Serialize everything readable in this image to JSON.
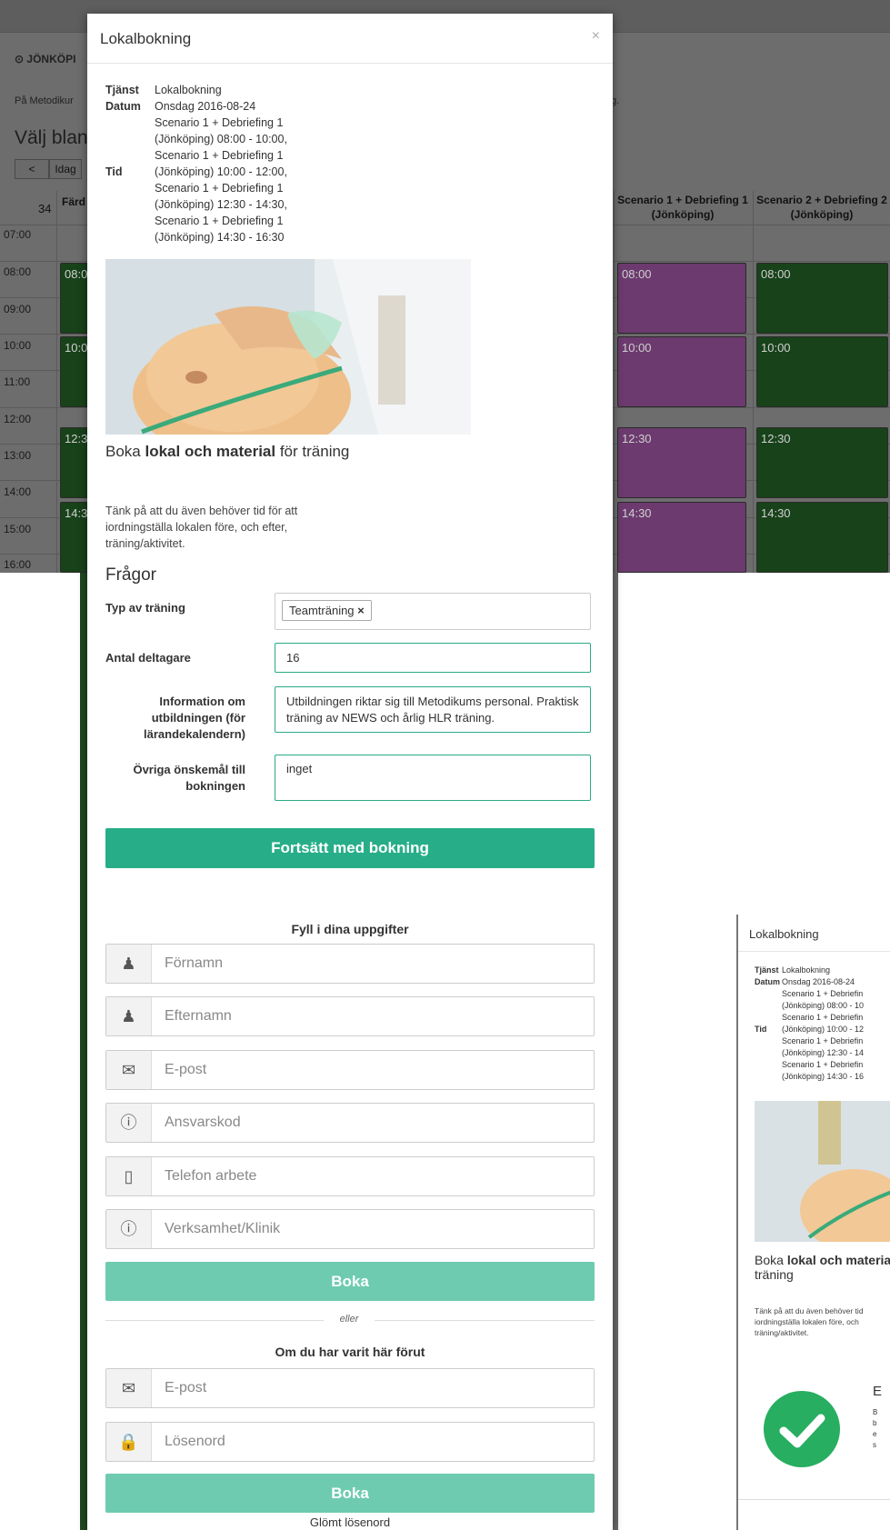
{
  "background": {
    "location_label": "JÖNKÖPI",
    "description_start": "På Metodikur",
    "description_end": "g.",
    "choose_heading": "Välj blan",
    "nav_prev": "<",
    "nav_today": "Idag",
    "week_number": "34",
    "first_column_label": "Färd",
    "column_headers": [
      "Scenario 1 + Debriefing 1 (Jönköping)",
      "Scenario 2 + Debriefing 2 (Jönköping)"
    ],
    "hours": [
      "07:00",
      "08:00",
      "09:00",
      "10:00",
      "11:00",
      "12:00",
      "13:00",
      "14:00",
      "15:00",
      "16:00"
    ],
    "left_event_labels": [
      "08:0",
      "10:0",
      "12:3",
      "14:3"
    ],
    "event_times": [
      "08:00",
      "10:00",
      "12:30",
      "14:30"
    ]
  },
  "modal": {
    "title": "Lokalbokning",
    "close": "×",
    "info": {
      "service_label": "Tjänst",
      "service_value": "Lokalbokning",
      "date_label": "Datum",
      "date_value": "Onsdag 2016-08-24",
      "time_label": "Tid",
      "time_lines": [
        "Scenario 1 + Debriefing 1",
        "(Jönköping) 08:00 - 10:00,",
        "Scenario 1 + Debriefing 1",
        "(Jönköping) 10:00 - 12:00,",
        "Scenario 1 + Debriefing 1",
        "(Jönköping) 12:30 - 14:30,",
        "Scenario 1 + Debriefing 1",
        "(Jönköping) 14:30 - 16:30"
      ]
    },
    "promo": {
      "title_part1": "Boka ",
      "title_bold": "lokal och material",
      "title_part2": " för träning",
      "text": "Tänk på att du även behöver tid för att iordningställa lokalen före, och efter, träning/aktivitet."
    },
    "questions": {
      "heading": "Frågor",
      "training_type_label": "Typ av träning",
      "training_type_tag": "Teamträning",
      "training_type_remove": "×",
      "participants_label": "Antal deltagare",
      "participants_value": "16",
      "info_label": "Information om utbildningen (för lärandekalendern)",
      "info_value": "Utbildningen riktar sig till Metodikums personal. Praktisk träning av NEWS och årlig HLR träning.",
      "wishes_label": "Övriga önskemål till bokningen",
      "wishes_value": "inget"
    },
    "continue_button": "Fortsätt med bokning",
    "details_heading": "Fyll i dina uppgifter",
    "fields": [
      {
        "icon": "user-icon",
        "placeholder": "Förnamn"
      },
      {
        "icon": "user-icon",
        "placeholder": "Efternamn"
      },
      {
        "icon": "envelope-icon",
        "placeholder": "E-post"
      },
      {
        "icon": "info-icon",
        "placeholder": "Ansvarskod"
      },
      {
        "icon": "phone-icon",
        "placeholder": "Telefon arbete"
      },
      {
        "icon": "info-icon",
        "placeholder": "Verksamhet/Klinik"
      }
    ],
    "book_button": "Boka",
    "or_text": "eller",
    "returning_heading": "Om du har varit här förut",
    "login_fields": [
      {
        "icon": "envelope-icon",
        "placeholder": "E-post"
      },
      {
        "icon": "lock-icon",
        "placeholder": "Lösenord"
      }
    ],
    "login_book_button": "Boka",
    "forgot_password": "Glömt lösenord"
  },
  "preview": {
    "title": "Lokalbokning",
    "service_label": "Tjänst",
    "service_value": "Lokalbokning",
    "date_label": "Datum",
    "date_value": "Onsdag 2016-08-24",
    "time_label": "Tid",
    "time_lines": [
      "Scenario 1 + Debriefin",
      "(Jönköping) 08:00 - 10",
      "Scenario 1 + Debriefin",
      "(Jönköping) 10:00 - 12",
      "Scenario 1 + Debriefin",
      "(Jönköping) 12:30 - 14",
      "Scenario 1 + Debriefin",
      "(Jönköping) 14:30 - 16"
    ],
    "promo_title_part1": "Boka ",
    "promo_title_bold": "lokal och material",
    "promo_title_part2": " träning",
    "promo_text": "Tänk på att du även behöver tid iordningställa lokalen före, och träning/aktivitet.",
    "confirm_initial": "E",
    "confirm_lines": [
      "B",
      "b",
      "e",
      "s"
    ]
  },
  "colors": {
    "accent": "#27ae89",
    "accent_light": "#6ecbb0",
    "event_green": "#18421a",
    "event_purple": "#6c3a6e",
    "success": "#27ae60"
  }
}
